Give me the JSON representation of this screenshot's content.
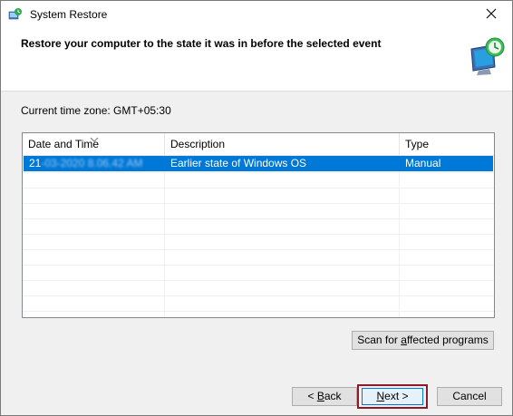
{
  "window": {
    "title": "System Restore"
  },
  "header": {
    "title": "Restore your computer to the state it was in before the selected event"
  },
  "timezone": {
    "label": "Current time zone: GMT+05:30"
  },
  "table": {
    "columns": [
      "Date and Time",
      "Description",
      "Type"
    ],
    "sorted_column": "Date and Time",
    "rows": [
      {
        "date_visible": "21",
        "date_blurred": "-03-2020 8.06.42 AM",
        "description": "Earlier state of Windows OS",
        "type": "Manual",
        "selected": true
      }
    ]
  },
  "buttons": {
    "scan_prefix": "Scan for ",
    "scan_accel": "a",
    "scan_suffix": "ffected programs",
    "back_prefix": "< ",
    "back_accel": "B",
    "back_suffix": "ack",
    "next_accel": "N",
    "next_suffix": "ext >",
    "cancel": "Cancel"
  },
  "colors": {
    "selection": "#0078d7",
    "highlight_box": "#8b1a2b"
  },
  "icons": {
    "title": "system-restore-icon",
    "header": "monitor-clock-restore-icon",
    "close": "close-icon",
    "sort": "sort-descending-icon"
  }
}
